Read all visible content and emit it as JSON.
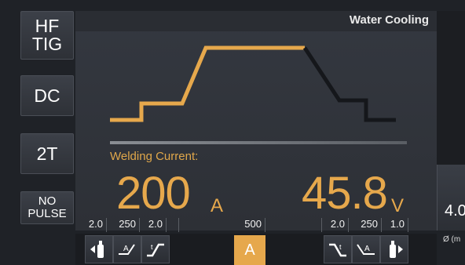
{
  "modes": {
    "process": [
      "HF",
      "TIG"
    ],
    "polarity": "DC",
    "trigger": "2T",
    "pulse": [
      "NO",
      "PULSE"
    ]
  },
  "header": {
    "cooling": "Water Cooling"
  },
  "readout": {
    "label": "Welding Current:",
    "current": "200",
    "current_unit": "A",
    "voltage": "45.8",
    "voltage_unit": "V"
  },
  "params": [
    "2.0",
    "250",
    "2.0",
    "500",
    "2.0",
    "250",
    "1.0"
  ],
  "toolbar": {
    "amp_label": "A"
  },
  "right_panel": {
    "value": "4.0",
    "unit": "Ø (m"
  },
  "colors": {
    "accent": "#e6a84c",
    "inactive_wave": "#15171b",
    "panel": "#343840"
  }
}
